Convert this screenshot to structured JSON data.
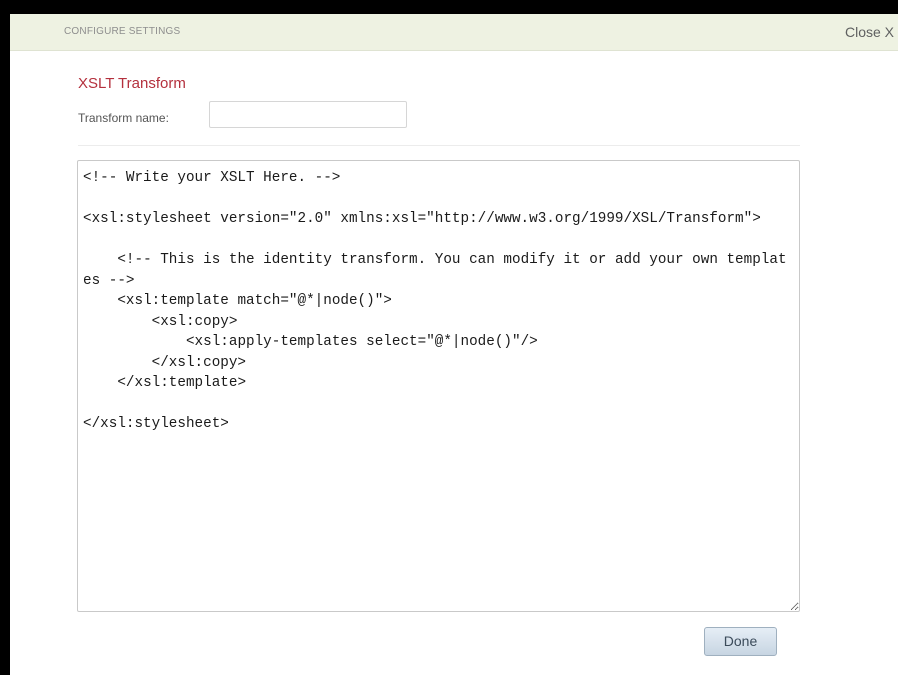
{
  "dialog": {
    "header_title": "CONFIGURE SETTINGS",
    "close_label": "Close X"
  },
  "form": {
    "section_title": "XSLT Transform",
    "transform_name_label": "Transform name:",
    "transform_name_value": "",
    "xslt_code": "<!-- Write your XSLT Here. -->\n\n<xsl:stylesheet version=\"2.0\" xmlns:xsl=\"http://www.w3.org/1999/XSL/Transform\">\n\n    <!-- This is the identity transform. You can modify it or add your own templates -->\n    <xsl:template match=\"@*|node()\">\n        <xsl:copy>\n            <xsl:apply-templates select=\"@*|node()\"/>\n        </xsl:copy>\n    </xsl:template>\n\n</xsl:stylesheet>",
    "done_label": "Done"
  }
}
